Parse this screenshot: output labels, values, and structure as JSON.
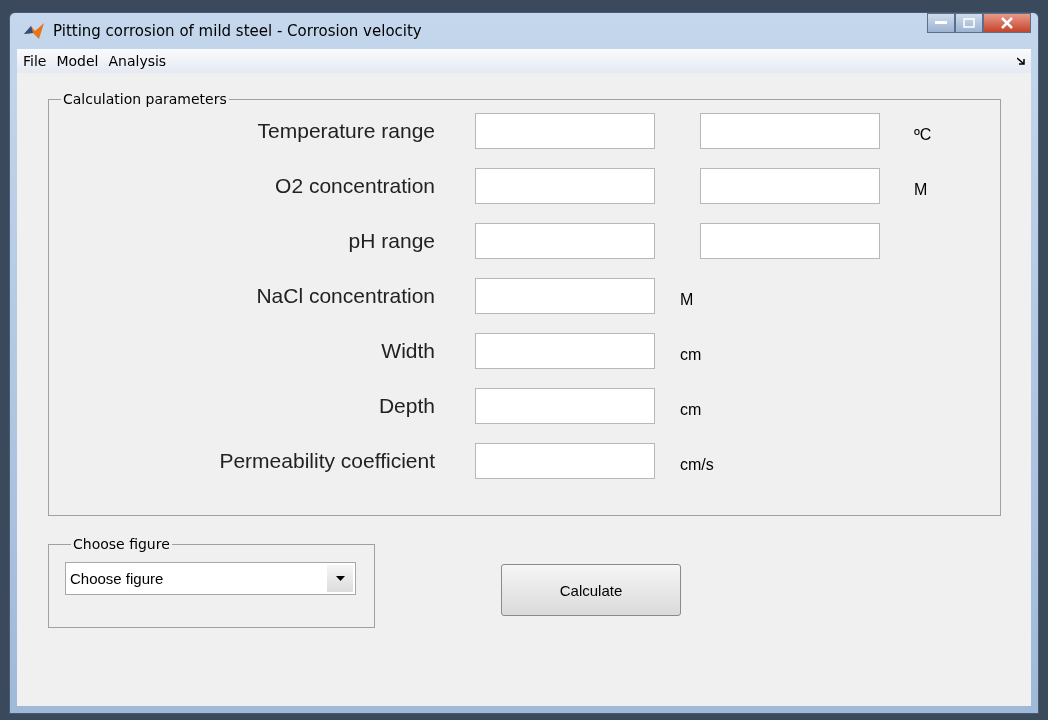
{
  "window": {
    "title": "Pitting corrosion of mild steel - Corrosion velocity"
  },
  "menu": [
    "File",
    "Model",
    "Analysis"
  ],
  "parameters": {
    "title": "Calculation parameters",
    "rows": [
      {
        "label": "Temperature range",
        "kind": "range",
        "unit": "ºC"
      },
      {
        "label": "O2 concentration",
        "kind": "range",
        "unit": "M"
      },
      {
        "label": "pH range",
        "kind": "range"
      },
      {
        "label": "NaCl concentration",
        "kind": "single",
        "unit": "M"
      },
      {
        "label": "Width",
        "kind": "single",
        "unit": "cm"
      },
      {
        "label": "Depth",
        "kind": "single",
        "unit": "cm"
      },
      {
        "label": "Permeability coefficient",
        "kind": "single",
        "unit": "cm/s"
      }
    ]
  },
  "figure": {
    "title": "Choose figure",
    "value": "Choose figure"
  },
  "buttons": [
    "Calculate"
  ]
}
